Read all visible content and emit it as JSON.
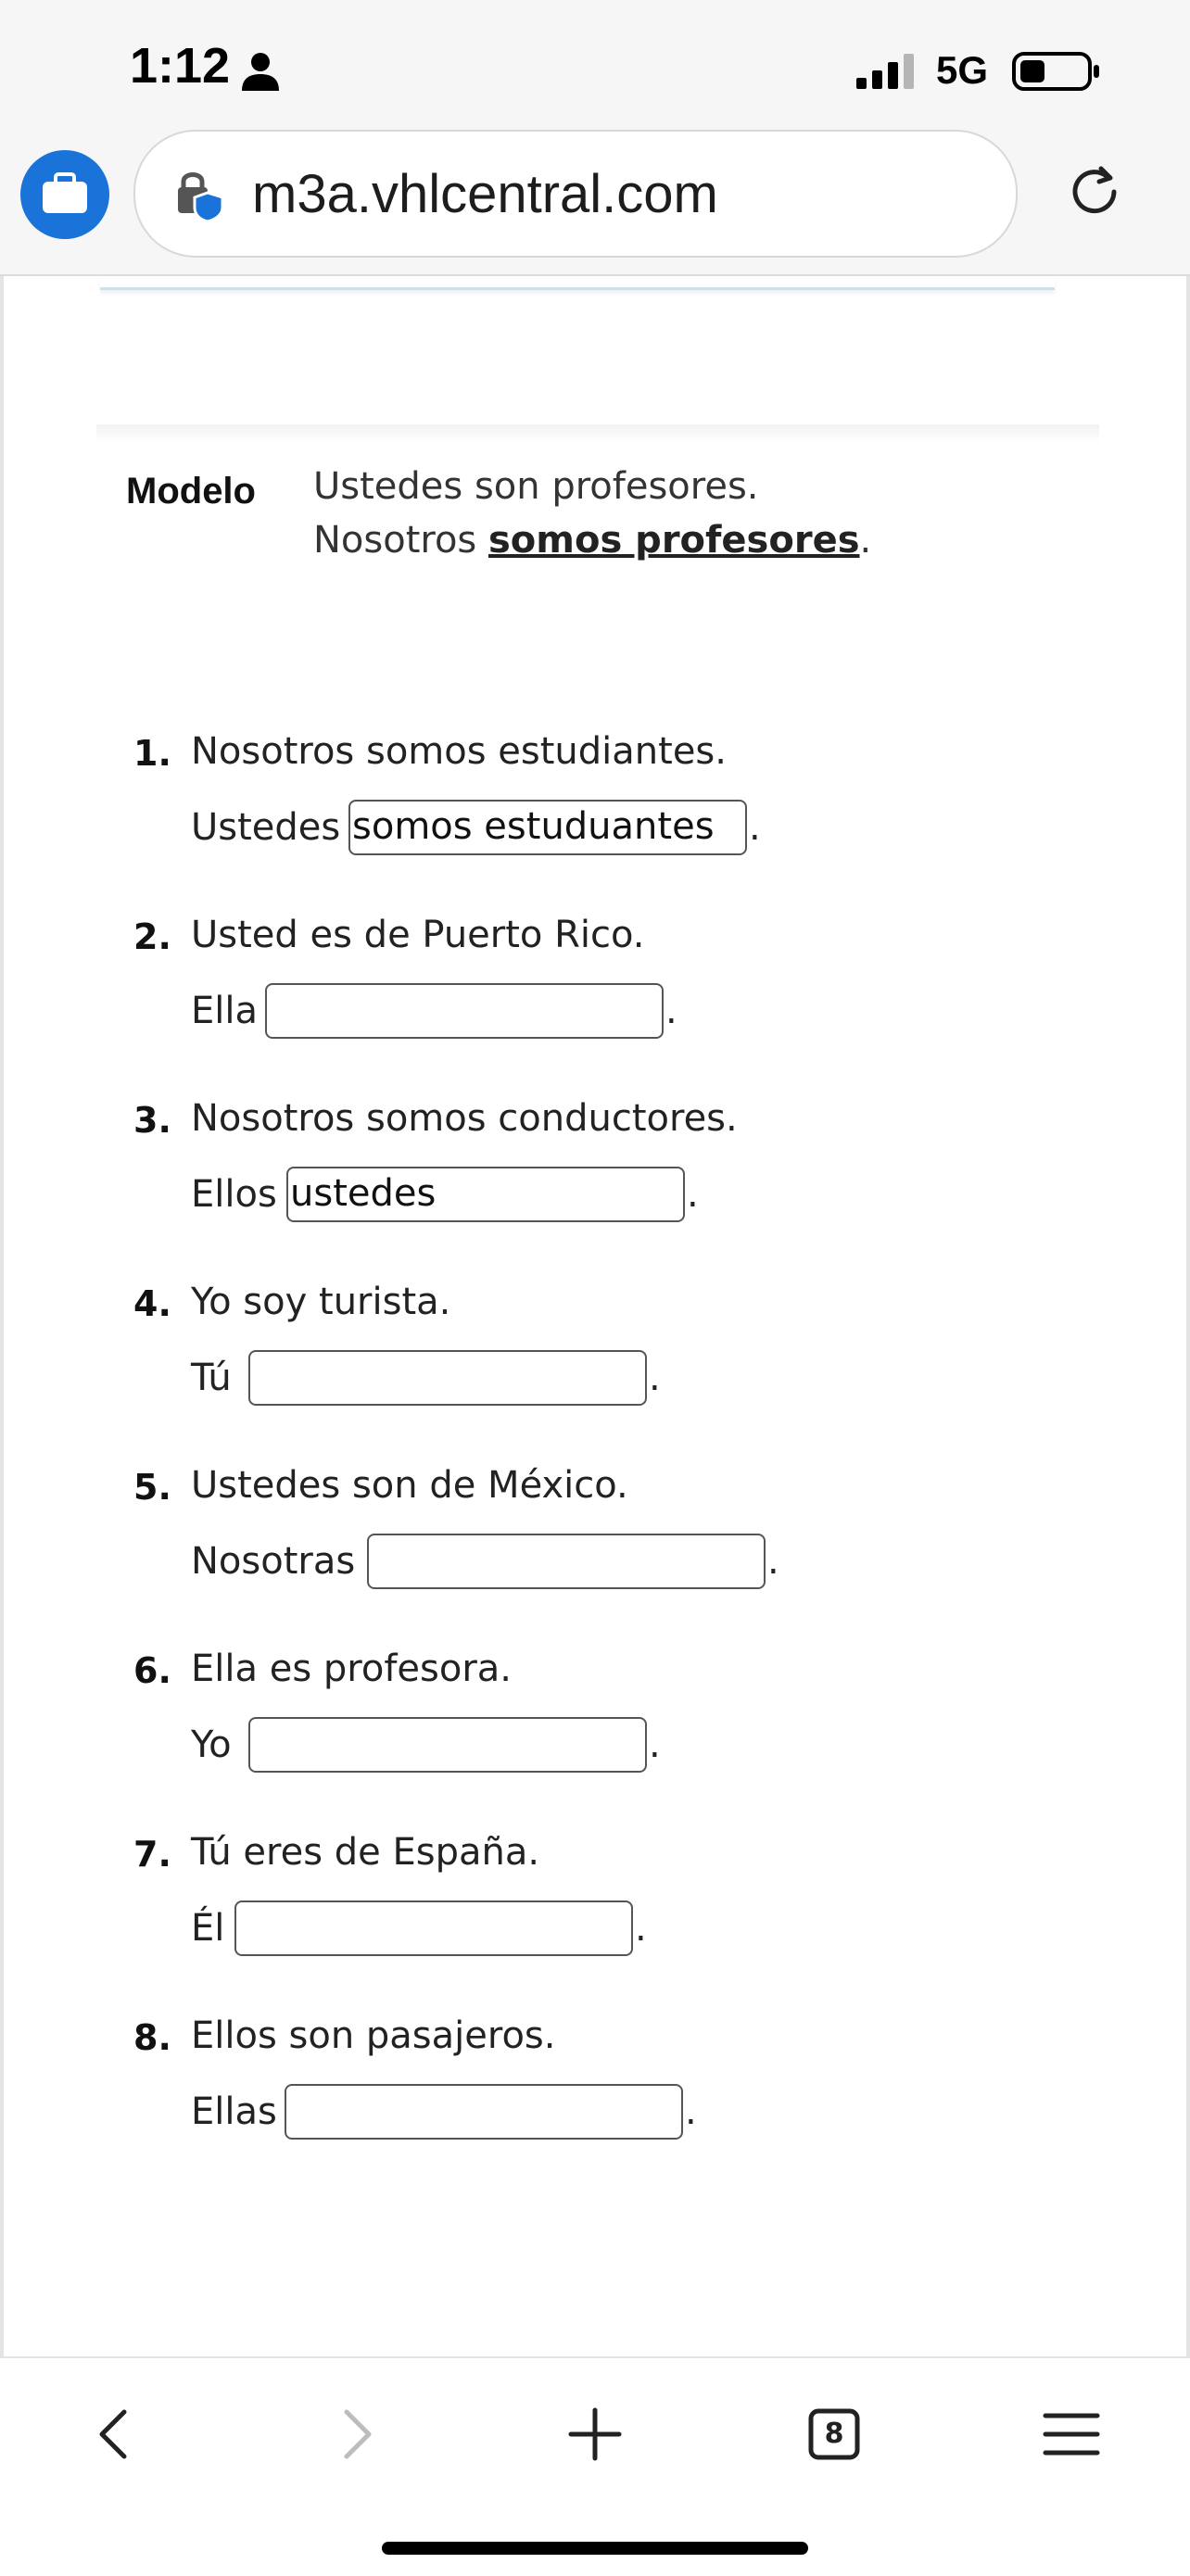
{
  "status_bar": {
    "time": "1:12",
    "network": "5G"
  },
  "browser": {
    "url": "m3a.vhlcentral.com",
    "tab_count": "8",
    "accent_color": "#1a73d9"
  },
  "modelo": {
    "label": "Modelo",
    "line1": "Ustedes son profesores.",
    "line2_subject": "Nosotros",
    "line2_answer": "somos profesores",
    "line2_end": "."
  },
  "items": [
    {
      "number": "1.",
      "prompt": "Nosotros somos estudiantes.",
      "subject": "Ustedes",
      "answer": "somos estuduantes",
      "period": "."
    },
    {
      "number": "2.",
      "prompt": "Usted es de Puerto Rico.",
      "subject": "Ella",
      "answer": "",
      "period": "."
    },
    {
      "number": "3.",
      "prompt": "Nosotros somos conductores.",
      "subject": "Ellos",
      "answer": "ustedes",
      "period": "."
    },
    {
      "number": "4.",
      "prompt": "Yo soy turista.",
      "subject": "Tú",
      "answer": "",
      "period": "."
    },
    {
      "number": "5.",
      "prompt": "Ustedes son de México.",
      "subject": "Nosotras",
      "answer": "",
      "period": "."
    },
    {
      "number": "6.",
      "prompt": "Ella es profesora.",
      "subject": "Yo",
      "answer": "",
      "period": "."
    },
    {
      "number": "7.",
      "prompt": "Tú eres de España.",
      "subject": "Él",
      "answer": "",
      "period": "."
    },
    {
      "number": "8.",
      "prompt": "Ellos son pasajeros.",
      "subject": "Ellas",
      "answer": "",
      "period": "."
    }
  ]
}
